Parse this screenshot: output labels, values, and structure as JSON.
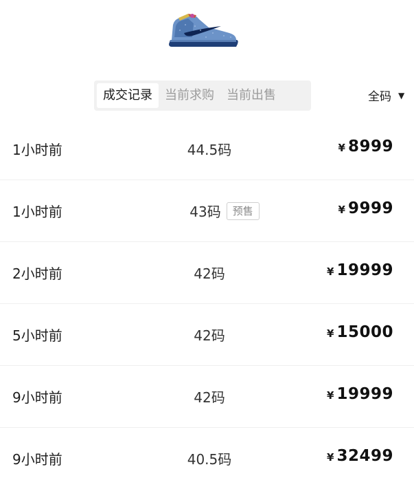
{
  "tabs": [
    {
      "label": "成交记录",
      "active": true
    },
    {
      "label": "当前求购",
      "active": false
    },
    {
      "label": "当前出售",
      "active": false
    }
  ],
  "size_filter": {
    "label": "全码",
    "icon": "caret-down-icon"
  },
  "records": [
    {
      "time": "1小时前",
      "size": "44.5码",
      "badge": "",
      "currency": "¥",
      "price": "8999"
    },
    {
      "time": "1小时前",
      "size": "43码",
      "badge": "预售",
      "currency": "¥",
      "price": "9999"
    },
    {
      "time": "2小时前",
      "size": "42码",
      "badge": "",
      "currency": "¥",
      "price": "19999"
    },
    {
      "time": "5小时前",
      "size": "42码",
      "badge": "",
      "currency": "¥",
      "price": "15000"
    },
    {
      "time": "9小时前",
      "size": "42码",
      "badge": "",
      "currency": "¥",
      "price": "19999"
    },
    {
      "time": "9小时前",
      "size": "40.5码",
      "badge": "",
      "currency": "¥",
      "price": "32499"
    }
  ]
}
